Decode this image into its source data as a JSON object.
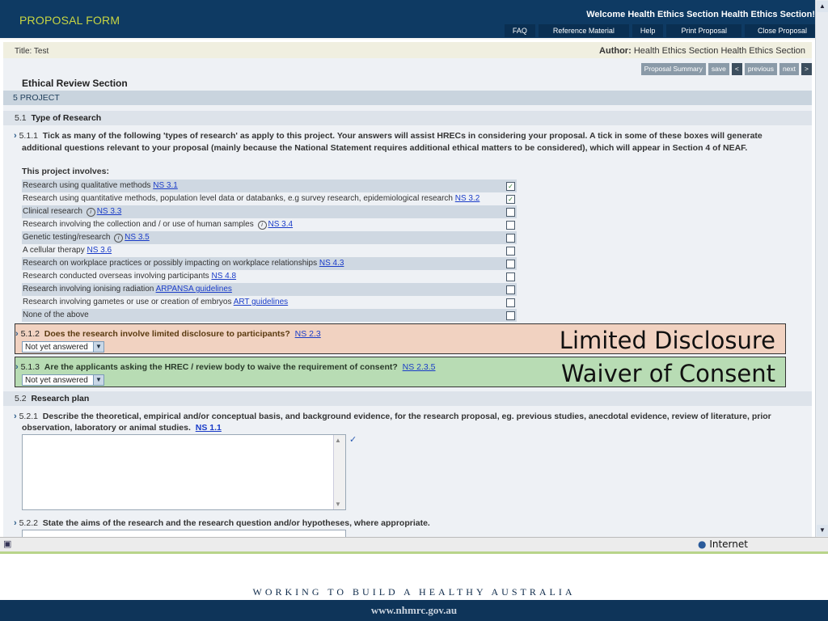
{
  "header": {
    "brand": "PROPOSAL FORM",
    "welcome": "Welcome Health Ethics Section Health Ethics Section!",
    "nav": [
      "FAQ",
      "Reference Material",
      "Help",
      "Print Proposal",
      "Close Proposal"
    ]
  },
  "titlebar": {
    "title": "Title: Test",
    "author_label": "Author:",
    "author_name": "Health Ethics Section Health Ethics Section"
  },
  "toolbar": {
    "summary": "Proposal Summary",
    "save": "save",
    "prev_arrow": "<",
    "previous": "previous",
    "next": "next",
    "next_arrow": ">"
  },
  "section_title": "Ethical Review Section",
  "section5": "5 PROJECT",
  "s51": {
    "num": "5.1",
    "title": "Type of Research"
  },
  "q511": {
    "num": "5.1.1",
    "text_line1": "Tick as many of the following 'types of research' as apply to this project. Your answers will assist HRECs in considering your proposal. A tick in some of these boxes will generate",
    "text_line2": "additional questions relevant to your proposal (mainly because the National Statement requires additional ethical matters to be considered), which will appear in Section 4 of NEAF.",
    "involves": "This project involves:"
  },
  "research_types": [
    {
      "label": "Research using qualitative methods",
      "link": "NS 3.1",
      "checked": true
    },
    {
      "label": "Research using quantitative methods, population level data or databanks, e.g survey research, epidemiological research",
      "link": "NS 3.2",
      "checked": true
    },
    {
      "label": "Clinical research",
      "info": true,
      "link": "NS 3.3",
      "checked": false
    },
    {
      "label": "Research involving the collection and / or use of human samples",
      "info": true,
      "link": "NS 3.4",
      "checked": false
    },
    {
      "label": "Genetic testing/research",
      "info": true,
      "link": "NS 3.5",
      "checked": false
    },
    {
      "label": "A cellular therapy",
      "link": "NS 3.6",
      "checked": false
    },
    {
      "label": "Research on workplace practices or possibly impacting on workplace relationships",
      "link": "NS 4.3",
      "checked": false
    },
    {
      "label": "Research conducted overseas involving participants",
      "link": "NS 4.8",
      "checked": false
    },
    {
      "label": "Research involving ionising radiation",
      "link": "ARPANSA guidelines",
      "checked": false
    },
    {
      "label": "Research involving gametes or use or creation of embryos",
      "link": "ART guidelines",
      "checked": false
    },
    {
      "label": "None of the above",
      "link": "",
      "checked": false
    }
  ],
  "q512": {
    "num": "5.1.2",
    "text": "Does the research involve limited disclosure to participants?",
    "link": "NS 2.3",
    "value": "Not yet answered",
    "callout": "Limited Disclosure",
    "color": "#f1d2c1"
  },
  "q513": {
    "num": "5.1.3",
    "text": "Are the applicants asking the HREC / review body to waive the requirement of consent?",
    "link": "NS 2.3.5",
    "value": "Not yet answered",
    "callout": "Waiver of Consent",
    "color": "#b8dcb4"
  },
  "s52": {
    "num": "5.2",
    "title": "Research plan"
  },
  "q521": {
    "num": "5.2.1",
    "text_line1": "Describe the theoretical, empirical and/or conceptual basis, and background evidence, for the research proposal, eg. previous studies, anecdotal evidence, review of literature, prior",
    "text_line2": "observation, laboratory or animal studies.",
    "link": "NS 1.1"
  },
  "q522": {
    "num": "5.2.2",
    "text": "State the aims of the research and the research question and/or hypotheses, where appropriate."
  },
  "status": {
    "zone": "Internet"
  },
  "footer": {
    "motto": "WORKING TO BUILD A HEALTHY AUSTRALIA",
    "url": "www.nhmrc.gov.au"
  }
}
